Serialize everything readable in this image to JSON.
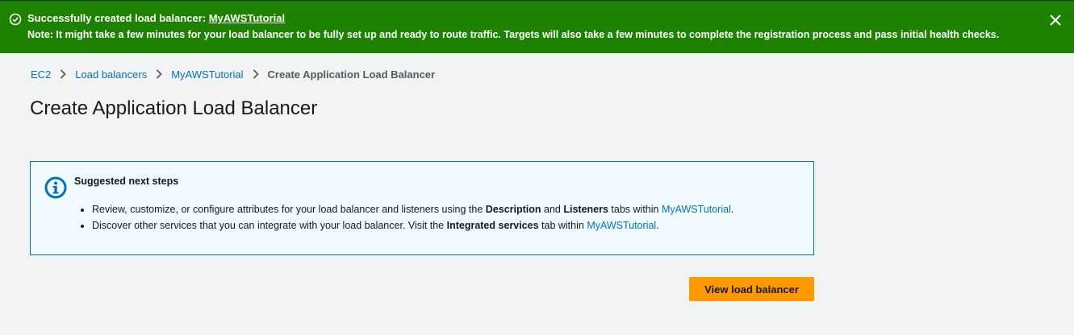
{
  "flash": {
    "title_prefix": "Successfully created load balancer: ",
    "title_link": "MyAWSTutorial",
    "note": "Note: It might take a few minutes for your load balancer to be fully set up and ready to route traffic. Targets will also take a few minutes to complete the registration process and pass initial health checks.",
    "status_icon": "check-circle-icon",
    "close_icon": "close-icon",
    "color": "#1d8102"
  },
  "breadcrumb": {
    "items": [
      "EC2",
      "Load balancers",
      "MyAWSTutorial"
    ],
    "current": "Create Application Load Balancer"
  },
  "page": {
    "title": "Create Application Load Balancer"
  },
  "info": {
    "icon": "info-icon",
    "heading": "Suggested next steps",
    "step1": {
      "pre": "Review, customize, or configure attributes for your load balancer and listeners using the ",
      "bold1": "Description",
      "mid": " and ",
      "bold2": "Listeners",
      "post": " tabs within ",
      "link": "MyAWSTutorial",
      "end": "."
    },
    "step2": {
      "pre": "Discover other services that you can integrate with your load balancer. Visit the ",
      "bold": "Integrated services",
      "post": " tab within ",
      "link": "MyAWSTutorial",
      "end": "."
    }
  },
  "actions": {
    "view_label": "View load balancer"
  },
  "colors": {
    "link": "#0073bb",
    "primary_button": "#ff9900",
    "info_border": "#0073bb",
    "info_bg": "#f1faff"
  }
}
